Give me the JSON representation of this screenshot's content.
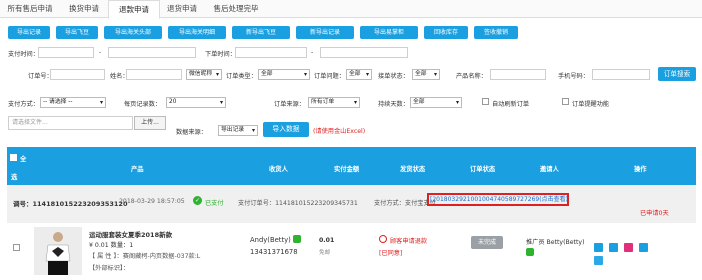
{
  "tabs": [
    "所有售后申请",
    "换货申请",
    "退款申请",
    "退货申请",
    "售后处理完毕"
  ],
  "toolbar_buttons": [
    "导出记录",
    "导出飞豆",
    "导出海关头部",
    "导出海关明细",
    "新导出飞豆",
    "新导出记录",
    "导出易掌柜",
    "回收库存",
    "签收撤销"
  ],
  "filters": {
    "pay_time": "支付时间：",
    "order_time": "下单时间：",
    "order_no": "订单号：",
    "name": "姓名：",
    "wechat_nick": "微信昵称",
    "order_type": "订单类型：",
    "order_type_val": "全部",
    "order_reject": "订单问题：",
    "order_reject_val": "全部",
    "ship_status": "接单状态：",
    "ship_status_val": "全部",
    "product_name": "产品名称：",
    "phone": "手机号码：",
    "search_btn": "订单搜索",
    "pay_method": "支付方式：",
    "pay_method_val": "-- 请选择 --",
    "per_page": "每页记录数：",
    "per_page_val": "20",
    "order_source": "订单来源：",
    "order_source_val": "所有订单",
    "delay_days": "持续天数：",
    "delay_days_val": "全部",
    "auto_refresh": "自动刷新订单",
    "order_reminder": "订单提醒功能",
    "file_placeholder": "请选择文件...",
    "upload_btn": "上传...",
    "data_source": "数据来源：",
    "data_source_val": "导出记录",
    "import_btn": "导入数据",
    "import_note": "(请使用金山Excel)"
  },
  "table_header": {
    "select_all": "全",
    "select_all_2": "选",
    "product": "产品",
    "receiver": "收货人",
    "paid": "实付金额",
    "ship_status": "发货状态",
    "order_status": "订单状态",
    "referrer": "邀请人",
    "ops": "操作"
  },
  "order": {
    "order_no": "调号：114181015223209353120",
    "time": "2018-03-29 18:57:05",
    "paid_status": "已支付",
    "pay_order_no": "支付订单号：114181015223209345731",
    "pay_method": "支付方式：支付宝支付",
    "pay_link": "[2018032921001004740589727269(点击查看)]",
    "days": "已申请0天"
  },
  "item": {
    "title": "运动服套装女夏季2018新款",
    "price": "¥ 0.01  数量：1",
    "attr": "【 属 性 】：赛阁藏柯-内页数据-037款:L",
    "extra": "【外部标识】：",
    "receiver_name": "Andy(Betty)",
    "receiver_phone": "13431371678",
    "paid_amount": "0.01",
    "paid_sub": "免邮",
    "refund_status": "顾客申请退款",
    "refund_sub": "[已同意]",
    "order_status_btn": "未完成",
    "referrer": "推广员 Betty(Betty)"
  },
  "colors": {
    "accent": "#1a9fe0",
    "danger": "#e02020",
    "success": "#2db32d"
  }
}
